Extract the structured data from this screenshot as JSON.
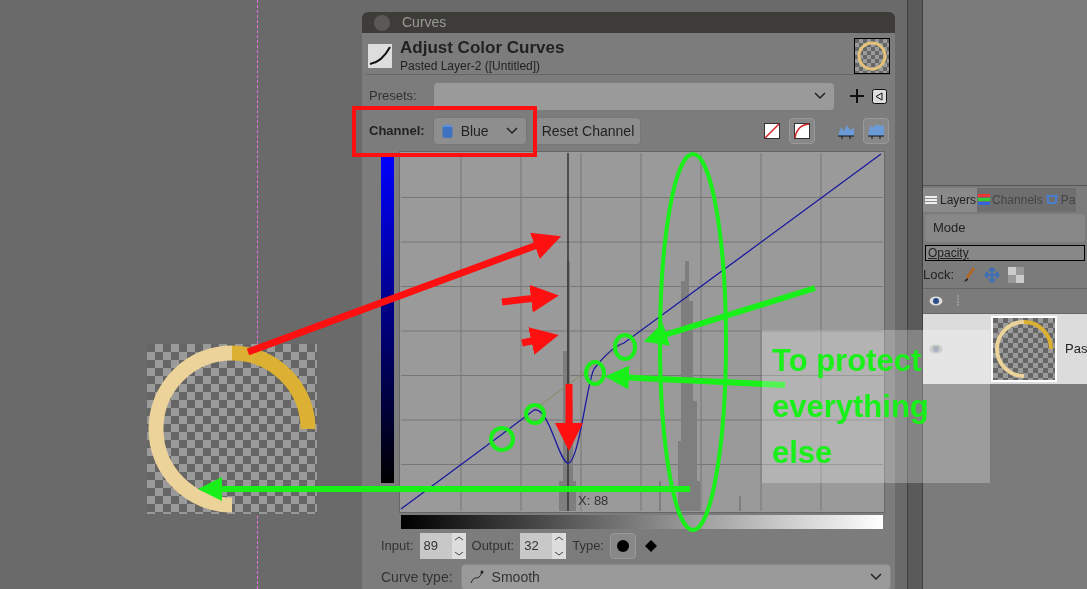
{
  "dialog": {
    "title": "Curves",
    "heading": "Adjust Color Curves",
    "subtitle": "Pasted Layer-2 ([Untitled])",
    "presets_label": "Presets:",
    "channel_label": "Channel:",
    "channel": "Blue",
    "reset_button": "Reset Channel",
    "curve_modes": [
      {
        "kind": "linear",
        "selected": false
      },
      {
        "kind": "curved",
        "selected": true
      }
    ],
    "histogram_scales": [
      {
        "kind": "linear",
        "selected": false
      },
      {
        "kind": "log",
        "selected": true
      }
    ],
    "cursor_readout": "X: 88",
    "input_label": "Input:",
    "input": "89",
    "output_label": "Output:",
    "output": "32",
    "type_label": "Type:",
    "point_types": [
      {
        "kind": "smooth",
        "selected": true
      },
      {
        "kind": "corner",
        "selected": false
      }
    ],
    "curve_type_label": "Curve type:",
    "curve_type": "Smooth"
  },
  "layers_panel": {
    "tabs": [
      {
        "label": "Layers",
        "selected": true
      },
      {
        "label": "Channels",
        "selected": false
      },
      {
        "label": "Pa",
        "selected": false
      }
    ],
    "mode_label": "Mode",
    "opacity_label": "Opacity",
    "lock_label": "Lock:",
    "layers": [
      {
        "name": "Pas",
        "visible": true
      }
    ]
  },
  "annotation": {
    "text": "To protect everything else"
  }
}
